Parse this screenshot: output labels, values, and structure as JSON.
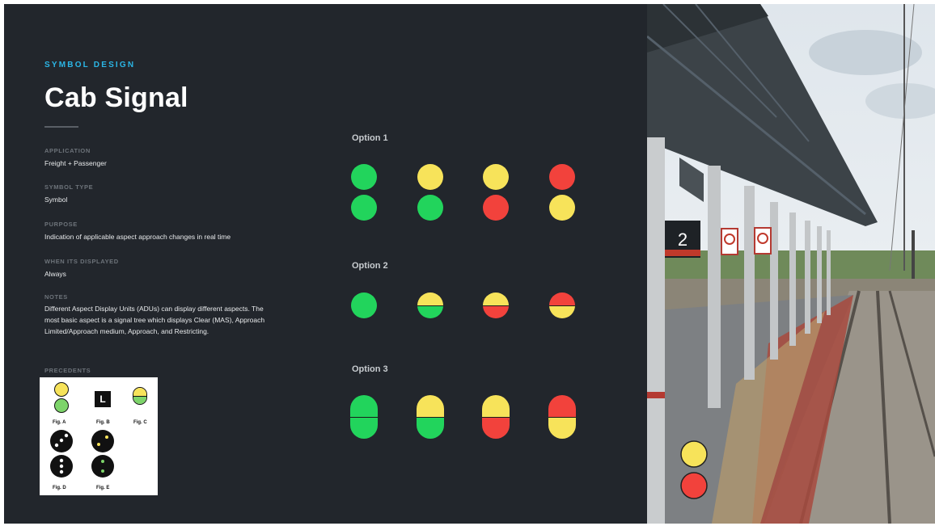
{
  "kicker": "SYMBOL DESIGN",
  "title": "Cab Signal",
  "fields": {
    "application_label": "APPLICATION",
    "application_value": "Freight + Passenger",
    "symbol_type_label": "SYMBOL TYPE",
    "symbol_type_value": "Symbol",
    "purpose_label": "PURPOSE",
    "purpose_value": "Indication of applicable aspect approach changes in real time",
    "when_label": "WHEN ITS DISPLAYED",
    "when_value": "Always",
    "notes_label": "NOTES",
    "notes_value": "Different Aspect Display Units (ADUs) can display different aspects. The most basic aspect is a signal tree which displays Clear (MAS), Approach Limited/Approach medium, Approach, and Restricting.",
    "precedents_label": "PRECEDENTS"
  },
  "precedents": {
    "fig_a": "Fig. A",
    "fig_b": "Fig. B",
    "fig_c": "Fig. C",
    "fig_d": "Fig. D",
    "fig_e": "Fig. E",
    "l_mark": "L"
  },
  "options": {
    "option1": "Option 1",
    "option2": "Option 2",
    "option3": "Option 3"
  },
  "photo": {
    "platform_number": "2"
  },
  "colors": {
    "green": "#22d45c",
    "yellow": "#f7e35a",
    "red": "#f2423c",
    "background": "#22262c",
    "accent": "#2bb6e6"
  }
}
